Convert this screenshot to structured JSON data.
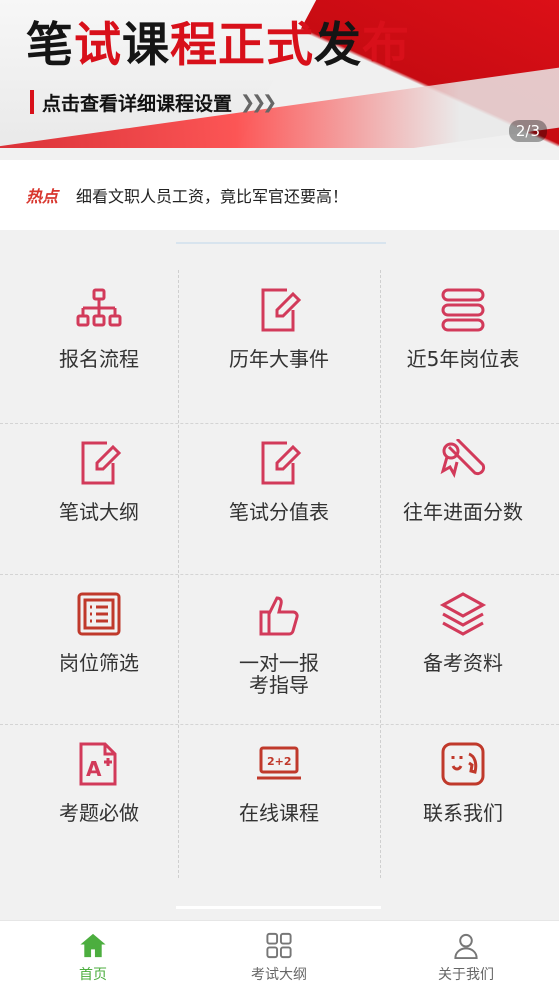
{
  "banner": {
    "title_parts": [
      "笔",
      "试",
      "课",
      "程",
      "正",
      "式",
      "发",
      "布"
    ],
    "subtitle": "点击查看详细课程设置",
    "arrows": "❯❯❯",
    "pager": "2/3"
  },
  "notice": {
    "tag": "热点",
    "text": "细看文职人员工资，竟比军官还要高！"
  },
  "grid": {
    "items": [
      {
        "label": "报名流程",
        "icon": "org-chart-icon"
      },
      {
        "label": "历年大事件",
        "icon": "edit-doc-icon"
      },
      {
        "label": "近5年岗位表",
        "icon": "list-stack-icon"
      },
      {
        "label": "笔试大纲",
        "icon": "edit-doc-icon"
      },
      {
        "label": "笔试分值表",
        "icon": "edit-doc-icon"
      },
      {
        "label": "往年进面分数",
        "icon": "diploma-icon"
      },
      {
        "label": "岗位筛选",
        "icon": "list-doc-icon"
      },
      {
        "label_line1": "一对一报",
        "label_line2": "考指导",
        "icon": "thumbs-up-icon"
      },
      {
        "label": "备考资料",
        "icon": "layers-icon"
      },
      {
        "label": "考题必做",
        "icon": "grade-a-icon"
      },
      {
        "label": "在线课程",
        "icon": "laptop-icon"
      },
      {
        "label": "联系我们",
        "icon": "phone-smile-icon"
      }
    ]
  },
  "tabbar": {
    "tabs": [
      {
        "label": "首页",
        "icon": "home-icon",
        "active": true
      },
      {
        "label": "考试大纲",
        "icon": "grid-icon",
        "active": false
      },
      {
        "label": "关于我们",
        "icon": "user-icon",
        "active": false
      }
    ]
  },
  "colors": {
    "accent": "#d23a5a",
    "active_tab": "#4cae3f",
    "brand_red": "#d8101a"
  }
}
